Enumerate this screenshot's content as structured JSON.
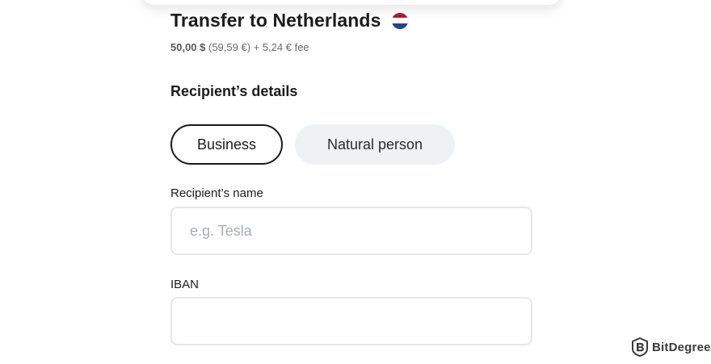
{
  "header": {
    "title": "Transfer to Netherlands",
    "flag_icon": "netherlands-flag-icon",
    "flag_colors": [
      "#ae1c28",
      "#ffffff",
      "#21468b"
    ],
    "amount": "50,00 $",
    "details": " (59,59 €) + 5,24 € fee"
  },
  "recipient": {
    "section_title": "Recipient’s details",
    "type_options": [
      {
        "label": "Business",
        "selected": true
      },
      {
        "label": "Natural person",
        "selected": false
      }
    ],
    "name_label": "Recipient’s name",
    "name_placeholder": "e.g. Tesla",
    "name_value": "",
    "iban_label": "IBAN",
    "iban_placeholder": "",
    "iban_value": ""
  },
  "watermark": {
    "text": "BitDegree",
    "icon": "bitdegree-logo-icon"
  },
  "colors": {
    "text_primary": "#1c1c1c",
    "text_secondary": "#6b6b6b",
    "selected_border": "#1a1a1a",
    "unselected_bg": "#f0f1f3",
    "input_border": "#e6e7ea",
    "placeholder": "#a9acb2"
  }
}
